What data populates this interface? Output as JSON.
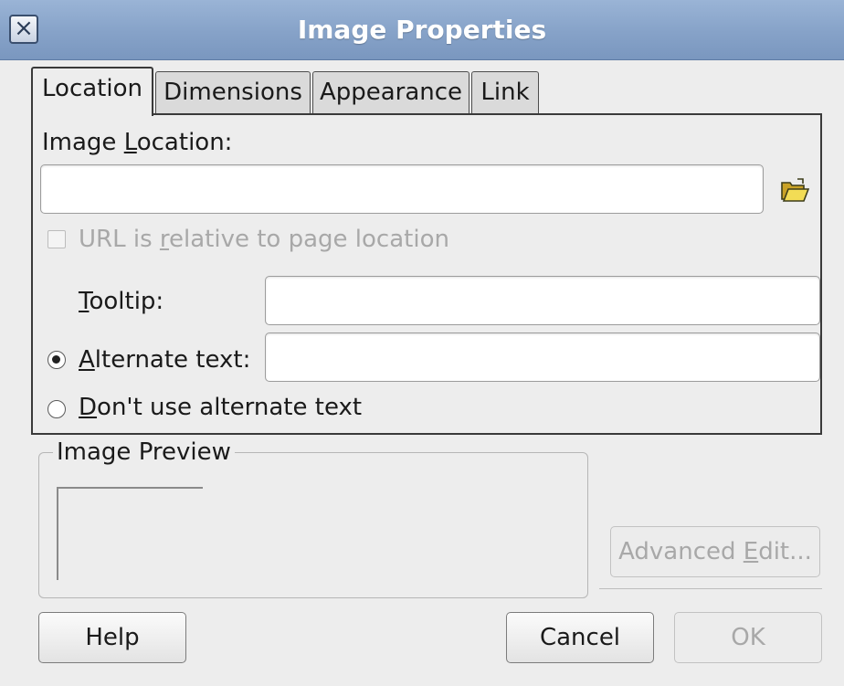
{
  "window": {
    "title": "Image Properties",
    "close_icon": "close-icon"
  },
  "tabs": [
    {
      "label": "Location",
      "active": true
    },
    {
      "label": "Dimensions",
      "active": false
    },
    {
      "label": "Appearance",
      "active": false
    },
    {
      "label": "Link",
      "active": false
    }
  ],
  "location": {
    "image_location_label_pre": "Image ",
    "image_location_label_key": "L",
    "image_location_label_post": "ocation:",
    "image_location_value": "",
    "browse_icon": "open-folder-icon",
    "relative_pre": "URL is ",
    "relative_key": "r",
    "relative_post": "elative to page location",
    "relative_checked": false,
    "relative_enabled": false,
    "tooltip_key": "T",
    "tooltip_post": "ooltip:",
    "tooltip_value": "",
    "alt_key": "A",
    "alt_post": "lternate text:",
    "alt_value": "",
    "alt_selected": true,
    "no_alt_key": "D",
    "no_alt_post": "on't use alternate text",
    "no_alt_selected": false
  },
  "preview": {
    "title": "Image Preview"
  },
  "buttons": {
    "advanced_pre": "Advanced ",
    "advanced_key": "E",
    "advanced_post": "dit...",
    "help": "Help",
    "cancel": "Cancel",
    "ok": "OK"
  },
  "colors": {
    "titlebar": "#86a2c8",
    "title_text": "#ffffff",
    "disabled_text": "#a8a8a8",
    "dialog_bg": "#ededed"
  }
}
